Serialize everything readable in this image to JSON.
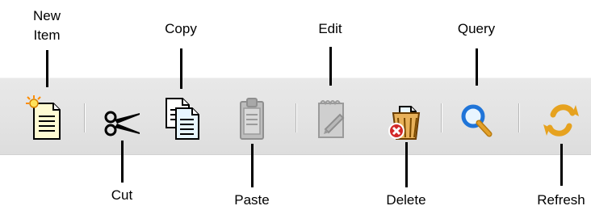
{
  "toolbar": {
    "items": [
      {
        "id": "new_item",
        "label": "New Item",
        "icon": "new-document-icon",
        "state": "enabled"
      },
      {
        "id": "cut",
        "label": "Cut",
        "icon": "scissors-icon",
        "state": "enabled"
      },
      {
        "id": "copy",
        "label": "Copy",
        "icon": "copy-icon",
        "state": "enabled"
      },
      {
        "id": "paste",
        "label": "Paste",
        "icon": "clipboard-icon",
        "state": "disabled"
      },
      {
        "id": "edit",
        "label": "Edit",
        "icon": "notepad-pencil-icon",
        "state": "disabled"
      },
      {
        "id": "delete",
        "label": "Delete",
        "icon": "trash-bin-delete-icon",
        "state": "enabled"
      },
      {
        "id": "query",
        "label": "Query",
        "icon": "magnifier-icon",
        "state": "enabled"
      },
      {
        "id": "refresh",
        "label": "Refresh",
        "icon": "refresh-arrows-icon",
        "state": "enabled"
      }
    ]
  },
  "colors": {
    "toolbar_background": "#e3e3e3",
    "label_text": "#000000",
    "callout_line": "#000000",
    "disabled_icon": "#a8a8a8",
    "delete_badge": "#d22828",
    "refresh_arrows": "#e6a21f",
    "query_lens": "#1f74d8"
  }
}
